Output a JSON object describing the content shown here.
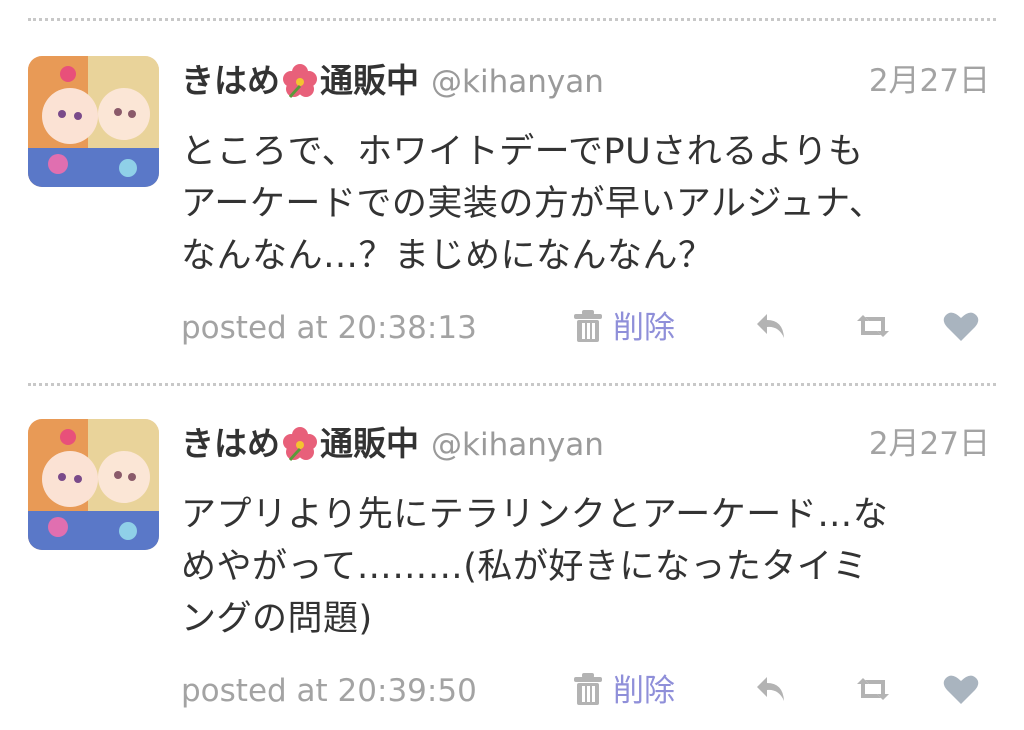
{
  "colors": {
    "name_text": "#333333",
    "muted_text": "#a3a3a3",
    "delete_link": "#8f8fd9",
    "icon_gray": "#b3b3b3",
    "heart": "#a9b4bf",
    "flower": "#e8607a"
  },
  "tweets": [
    {
      "name_part1": "きはめ",
      "name_part2": "通販中",
      "name_emoji_icon": "hibiscus-icon",
      "handle": "@kihanyan",
      "date": "2月27日",
      "text": "ところで、ホワイトデーでPUされるよりも\nアーケードでの実装の方が早いアルジュナ、\nなんなん…？まじめになんなん？",
      "posted": "posted at 20:38:13",
      "delete_label": "削除"
    },
    {
      "name_part1": "きはめ",
      "name_part2": "通販中",
      "name_emoji_icon": "hibiscus-icon",
      "handle": "@kihanyan",
      "date": "2月27日",
      "text": "アプリより先にテラリンクとアーケード…な\nめやがって………(私が好きになったタイミ\nングの問題)",
      "posted": "posted at 20:39:50",
      "delete_label": "削除"
    }
  ]
}
